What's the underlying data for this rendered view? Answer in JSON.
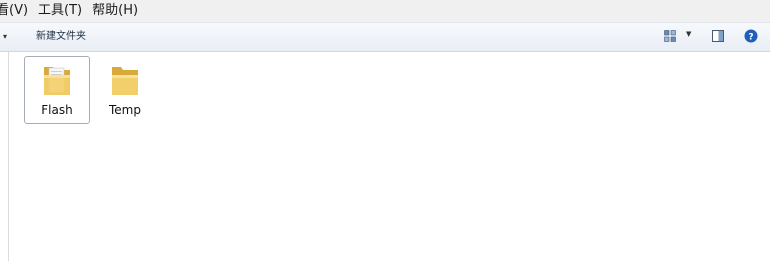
{
  "menubar": {
    "items": [
      {
        "label": "看(V)"
      },
      {
        "label": "工具(T)"
      },
      {
        "label": "帮助(H)"
      }
    ]
  },
  "toolbar": {
    "new_folder_label": "新建文件夹",
    "icons": [
      "views-icon",
      "chevron-down-icon",
      "preview-pane-icon",
      "help-icon"
    ]
  },
  "files": [
    {
      "name": "Flash",
      "type": "folder",
      "selected": true
    },
    {
      "name": "Temp",
      "type": "folder",
      "selected": false
    }
  ],
  "colors": {
    "folder_yellow": "#f2cf6a",
    "folder_dark": "#d9a93a",
    "help_blue": "#1f5fb8",
    "toolbar_bg": "#eaf0f7"
  }
}
